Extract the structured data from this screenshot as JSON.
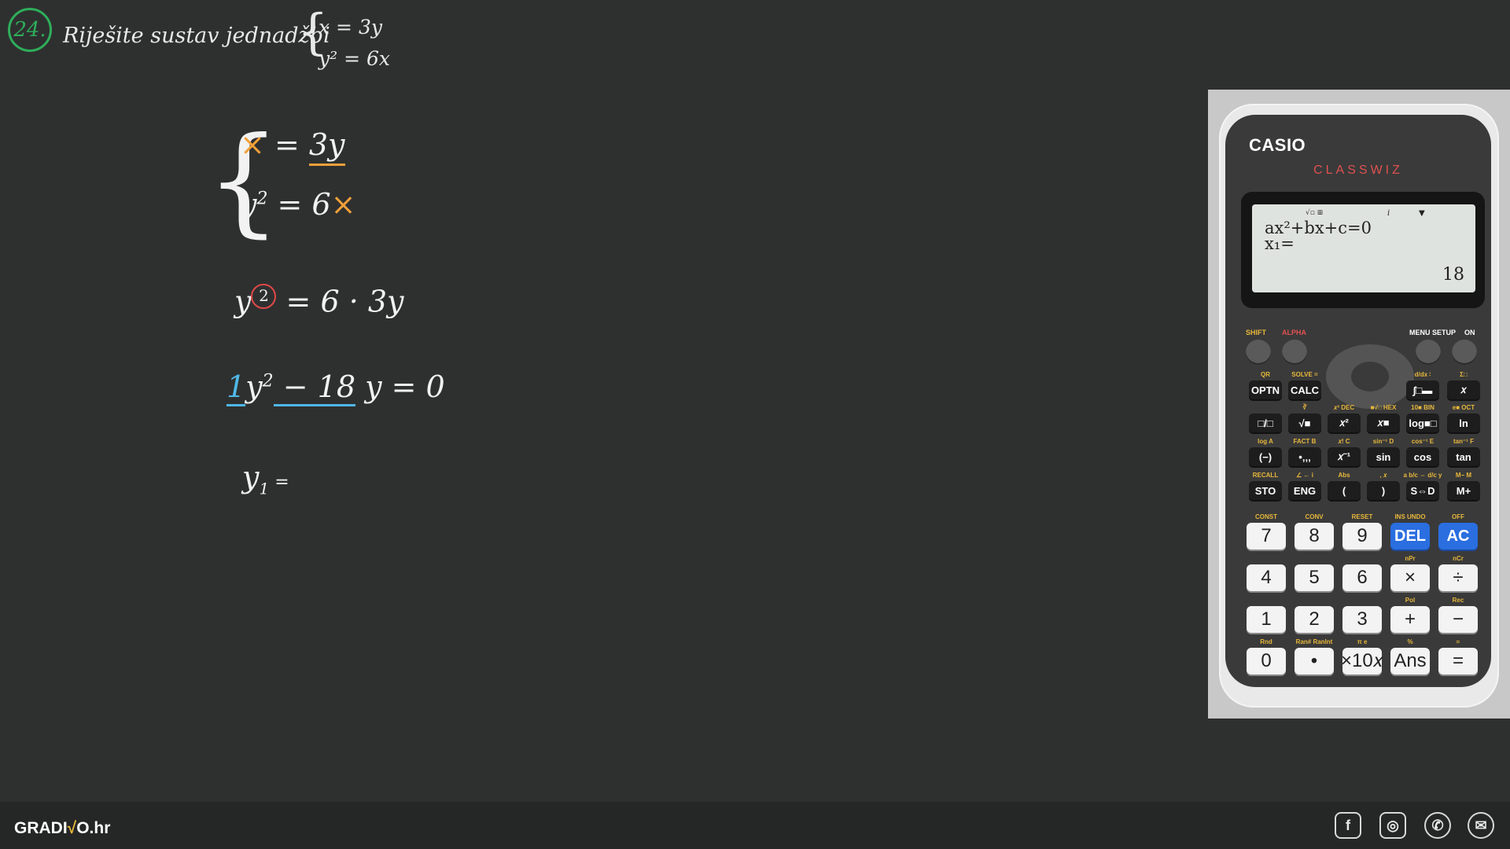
{
  "task": {
    "number": "24.",
    "instruction": "Riješite sustav jednadžbi",
    "eq1": "x = 3y",
    "eq2": "y² = 6x"
  },
  "work": {
    "line1_x": "×",
    "line1_rest": "= ",
    "line1_rhs": "3y",
    "line2_lhs": "y",
    "line2_exp": "2",
    "line2_eq": " = 6",
    "line2_x": "×",
    "line3_lhs": "y",
    "line3_exp": "2",
    "line3_rhs": " = 6 · 3y",
    "line4_coef": "1",
    "line4_y": "y",
    "line4_exp": "2",
    "line4_b": " − 18",
    "line4_rest": " y = 0",
    "line5": "y",
    "line5_sub": "1",
    "line5_rest": " ="
  },
  "calculator": {
    "brand": "CASIO",
    "model": "CLASSWIZ",
    "screen": {
      "icons": "√▫ ⊞",
      "i_indicator": "i",
      "arrow": "▼",
      "line1": "ax²+bx+c=0",
      "line2": "x₁=",
      "result": "18"
    },
    "top_labels": {
      "shift": "SHIFT",
      "alpha": "ALPHA",
      "menu": "MENU SETUP",
      "on": "ON"
    },
    "fn_rows": [
      [
        {
          "label": "OPTN",
          "sub": "QR"
        },
        {
          "label": "CALC",
          "sub": "SOLVE ="
        },
        {
          "label": "∫□▬",
          "sub": "d/dx ∶"
        },
        {
          "label": "𝑥",
          "sub": "Σ□"
        }
      ],
      [
        {
          "label": "□/□",
          "sub": ""
        },
        {
          "label": "√■",
          "sub": "∛"
        },
        {
          "label": "𝑥²",
          "sub": "𝑥³ DEC"
        },
        {
          "label": "𝑥■",
          "sub": "■√□ HEX"
        },
        {
          "label": "log■□",
          "sub": "10■ BIN"
        },
        {
          "label": "ln",
          "sub": "e■ OCT"
        }
      ],
      [
        {
          "label": "(−)",
          "sub": "log A"
        },
        {
          "label": "•‚‚‚",
          "sub": "FACT B"
        },
        {
          "label": "𝑥⁻¹",
          "sub": "𝑥! C"
        },
        {
          "label": "sin",
          "sub": "sin⁻¹ D"
        },
        {
          "label": "cos",
          "sub": "cos⁻¹ E"
        },
        {
          "label": "tan",
          "sub": "tan⁻¹ F"
        }
      ],
      [
        {
          "label": "STO",
          "sub": "RECALL"
        },
        {
          "label": "ENG",
          "sub": "∠ ← i"
        },
        {
          "label": "(",
          "sub": "Abs"
        },
        {
          "label": ")",
          "sub": ", 𝑥"
        },
        {
          "label": "S⇔D",
          "sub": "a b/c ⇔ d/c y"
        },
        {
          "label": "M+",
          "sub": "M− M"
        }
      ]
    ],
    "num_rows": [
      [
        {
          "label": "7",
          "sub": "CONST",
          "blue": false
        },
        {
          "label": "8",
          "sub": "CONV",
          "blue": false
        },
        {
          "label": "9",
          "sub": "RESET",
          "blue": false
        },
        {
          "label": "DEL",
          "sub": "INS UNDO",
          "blue": true
        },
        {
          "label": "AC",
          "sub": "OFF",
          "blue": true
        }
      ],
      [
        {
          "label": "4",
          "sub": "",
          "blue": false
        },
        {
          "label": "5",
          "sub": "",
          "blue": false
        },
        {
          "label": "6",
          "sub": "",
          "blue": false
        },
        {
          "label": "×",
          "sub": "nPr",
          "blue": false
        },
        {
          "label": "÷",
          "sub": "nCr",
          "blue": false
        }
      ],
      [
        {
          "label": "1",
          "sub": "",
          "blue": false
        },
        {
          "label": "2",
          "sub": "",
          "blue": false
        },
        {
          "label": "3",
          "sub": "",
          "blue": false
        },
        {
          "label": "+",
          "sub": "Pol",
          "blue": false
        },
        {
          "label": "−",
          "sub": "Rec",
          "blue": false
        }
      ],
      [
        {
          "label": "0",
          "sub": "Rnd",
          "blue": false
        },
        {
          "label": "•",
          "sub": "Ran# RanInt",
          "blue": false
        },
        {
          "label": "×10𝑥",
          "sub": "π e",
          "blue": false
        },
        {
          "label": "Ans",
          "sub": "%",
          "blue": false
        },
        {
          "label": "=",
          "sub": "≈",
          "blue": false
        }
      ]
    ]
  },
  "footer": {
    "logo_prefix": "GRADI",
    "logo_v": "√",
    "logo_suffix": "O.hr",
    "social": [
      "f",
      "◎",
      "✆",
      "✉"
    ]
  },
  "colors": {
    "background": "#2e3030",
    "accent_orange": "#f2a03a",
    "accent_blue": "#4fb8e8",
    "accent_red": "#e04848",
    "badge_green": "#2fae5a"
  }
}
